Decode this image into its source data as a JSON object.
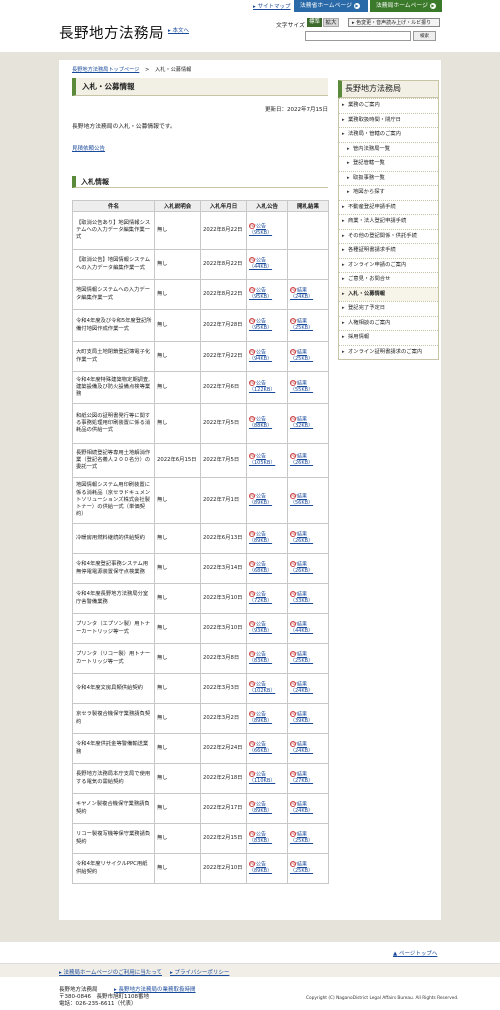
{
  "topbar": {
    "sitemap": "サイトマップ",
    "moj_link": "法務省ホームページ",
    "bureau_link": "法務局ホームページ"
  },
  "header": {
    "logo": "長野地方法務局",
    "skip": "本文へ",
    "fontsize_label": "文字サイズ",
    "fontsize_standard": "標準",
    "fontsize_large": "拡大",
    "a11y_button": "色変更・音声読み上げ・ルビ振り",
    "search_button": "検索",
    "search_placeholder": ""
  },
  "breadcrumb": {
    "home": "長野地方法務局トップページ",
    "sep": ">",
    "current": "入札・公募情報"
  },
  "main": {
    "title": "入札・公募情報",
    "updated": "更新日：2022年7月15日",
    "intro": "長野地方法務局の入札・公募情報です。",
    "quote_link": "見積依頼公告",
    "section_title": "入札情報"
  },
  "table": {
    "headers": [
      "件名",
      "入札説明会",
      "入札年月日",
      "入札公告",
      "開札結果"
    ],
    "rows": [
      {
        "name": "【取消公告あり】地図情報システムへの入力データ編集作業一式",
        "briefing": "無し",
        "date": "2022年8月22日",
        "notice": "公告（95KB）",
        "result": ""
      },
      {
        "name": "【取消公告】地図情報システムへの入力データ編集作業一式",
        "briefing": "無し",
        "date": "2022年8月22日",
        "notice": "公告（44KB）",
        "result": ""
      },
      {
        "name": "地図情報システムへの入力データ編集作業一式",
        "briefing": "無し",
        "date": "2022年8月22日",
        "notice": "公告（95KB）",
        "result": "結果（24KB）"
      },
      {
        "name": "令和4年度及び令和5年度登記所備付地図作成作業一式",
        "briefing": "無し",
        "date": "2022年7月28日",
        "notice": "公告（95KB）",
        "result": "結果（25KB）"
      },
      {
        "name": "大町支局土地閉鎖登記簿電子化作業一式",
        "briefing": "無し",
        "date": "2022年7月22日",
        "notice": "公告（94KB）",
        "result": "結果（25KB）"
      },
      {
        "name": "令和4年度特殊建築物定期調査,建築設備及び防火設備点検等業務",
        "briefing": "無し",
        "date": "2022年7月6日",
        "notice": "公告（122KB）",
        "result": "結果（55KB）"
      },
      {
        "name": "和紙公図の証明書発行等に関する事務処理用印刷装置に係る消耗品の供給一式",
        "briefing": "無し",
        "date": "2022年7月5日",
        "notice": "公告（88KB）",
        "result": "結果（32KB）"
      },
      {
        "name": "長野相続登記等専用土地解消作業（登記名義人２００名分）の委託一式",
        "briefing": "2022年6月15日",
        "date": "2022年7月5日",
        "notice": "公告（105KB）",
        "result": "結果（26KB）"
      },
      {
        "name": "地図情報システム用印刷装置に係る消耗品（京セラドキュメントソリューションズ株式会社製トナー）の供給一式（単価契約）",
        "briefing": "無し",
        "date": "2022年7月1日",
        "notice": "公告（89KB）",
        "result": "結果（56KB）"
      },
      {
        "name": "冷暖房用燃料継続的供給契約",
        "briefing": "無し",
        "date": "2022年6月13日",
        "notice": "公告（89KB）",
        "result": "結果（26KB）"
      },
      {
        "name": "令和4年度登記事務システム用無停電電源装置保守点検業務",
        "briefing": "無し",
        "date": "2022年3月14日",
        "notice": "公告（68KB）",
        "result": "結果（26KB）"
      },
      {
        "name": "令和4年度長野地方法務局分室庁舎警備業務",
        "briefing": "無し",
        "date": "2022年3月10日",
        "notice": "公告（72KB）",
        "result": "結果（33KB）"
      },
      {
        "name": "プリンタ（エプソン製）用トナーカートリッジ等一式",
        "briefing": "無し",
        "date": "2022年3月10日",
        "notice": "公告（93KB）",
        "result": "結果（44KB）"
      },
      {
        "name": "プリンタ（リコー製）用トナーカートリッジ等一式",
        "briefing": "無し",
        "date": "2022年3月8日",
        "notice": "公告（83KB）",
        "result": "結果（25KB）"
      },
      {
        "name": "令和4年度文房具類供給契約",
        "briefing": "無し",
        "date": "2022年3月3日",
        "notice": "公告（102KB）",
        "result": "結果（24KB）"
      },
      {
        "name": "京セラ製複合機保守業務請負契約",
        "briefing": "無し",
        "date": "2022年3月2日",
        "notice": "公告（89KB）",
        "result": "結果（39KB）"
      },
      {
        "name": "令和4年度供託金等警備輸送業務",
        "briefing": "無し",
        "date": "2022年2月24日",
        "notice": "公告（66KB）",
        "result": "結果（24KB）"
      },
      {
        "name": "長野地方法務局本庁支局で使用する電気の需給契約",
        "briefing": "無し",
        "date": "2022年2月18日",
        "notice": "公告（110KB）",
        "result": "結果（27KB）"
      },
      {
        "name": "キヤノン製複合機保守業務請負契約",
        "briefing": "無し",
        "date": "2022年2月17日",
        "notice": "公告（89KB）",
        "result": "結果（24KB）"
      },
      {
        "name": "リコー製複写機等保守業務請負契約",
        "briefing": "無し",
        "date": "2022年2月15日",
        "notice": "公告（83KB）",
        "result": "結果（25KB）"
      },
      {
        "name": "令和4年度リサイクルPPC用紙供給契約",
        "briefing": "無し",
        "date": "2022年2月10日",
        "notice": "公告（89KB）",
        "result": "結果（25KB）"
      }
    ]
  },
  "sidebar": {
    "title": "長野地方法務局",
    "items": [
      {
        "label": "業務のご案内",
        "sub": false,
        "active": false
      },
      {
        "label": "業務取扱時間・閉庁日",
        "sub": false,
        "active": false
      },
      {
        "label": "法務局・管轄のご案内",
        "sub": false,
        "active": false
      },
      {
        "label": "管内法務局一覧",
        "sub": true,
        "active": false
      },
      {
        "label": "登記管轄一覧",
        "sub": true,
        "active": false
      },
      {
        "label": "取扱事務一覧",
        "sub": true,
        "active": false
      },
      {
        "label": "地図から探す",
        "sub": true,
        "active": false
      },
      {
        "label": "不動産登記申請手続",
        "sub": false,
        "active": false
      },
      {
        "label": "商業・法人登記申請手続",
        "sub": false,
        "active": false
      },
      {
        "label": "その他の登記関係・供託手続",
        "sub": false,
        "active": false
      },
      {
        "label": "各種証明書請求手続",
        "sub": false,
        "active": false
      },
      {
        "label": "オンライン申請のご案内",
        "sub": false,
        "active": false
      },
      {
        "label": "ご意見・お問合せ",
        "sub": false,
        "active": false
      },
      {
        "label": "入札・公募情報",
        "sub": false,
        "active": true
      },
      {
        "label": "登記完了予定日",
        "sub": false,
        "active": false
      },
      {
        "label": "人権相談のご案内",
        "sub": false,
        "active": false
      },
      {
        "label": "採用情報",
        "sub": false,
        "active": false
      },
      {
        "label": "オンライン証明書請求のご案内",
        "sub": false,
        "active": false
      }
    ]
  },
  "pagetop": "ページトップへ",
  "footer": {
    "link1": "法務局ホームページのご利用に当たって",
    "link2": "プライバシーポリシー",
    "name": "長野地方法務局",
    "map_link": "長野地方法務局の業務取扱時間",
    "address": "〒380-0846　長野市旭町1108番地",
    "tel": "電話：026-235-6611（代表）",
    "copyright": "Copyright (C) NaganoDistrict Legal Affairs Bureau. All Rights Reserved."
  }
}
